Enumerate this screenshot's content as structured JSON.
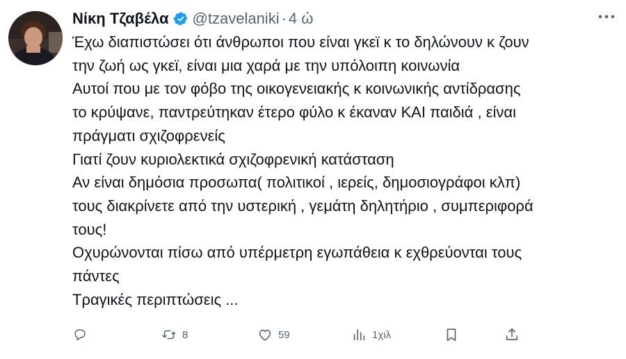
{
  "author": {
    "name": "Νίκη Τζαβέλα",
    "handle": "@tzavelaniki",
    "separator": "·",
    "time": "4 ώ",
    "verified": true
  },
  "avatar_icon": "profile-photo",
  "more_icon": "more-horizontal-icon",
  "tweet_lines": [
    "Έχω διαπιστώσει ότι άνθρωποι που είναι γκεϊ κ το δηλώνουν κ ζουν",
    "την ζωή ως γκεϊ, είναι μια χαρά με την υπόλοιπη κοινωνία",
    "Αυτοί που με τον φόβο της οικογενειακής κ κοινωνικής αντίδρασης",
    "το κρύψανε, παντρεύτηκαν έτερο φύλο κ έκαναν ΚΑΙ παιδιά , είναι",
    "πράγματι σχιζοφρενείς",
    "Γιατί ζουν κυριολεκτικά σχιζοφρενική κατάσταση",
    "Αν είναι δημόσια προσωπα( πολιτικοί , ιερείς, δημοσιογράφοι κλπ)",
    "τους διακρίνετε από την υστερική , γεμάτη δηλητήριο , συμπεριφορά",
    "τους!",
    "Οχυρώνονται πίσω από υπέρμετρη εγωπάθεια κ εχθρεύονται τους",
    "πάντες",
    "Τραγικές περιπτώσεις ..."
  ],
  "actions": {
    "reply": {
      "icon": "reply-icon",
      "count": ""
    },
    "retweet": {
      "icon": "retweet-icon",
      "count": "8"
    },
    "like": {
      "icon": "heart-icon",
      "count": "59"
    },
    "views": {
      "icon": "views-icon",
      "count": "1χιλ"
    },
    "bookmark": {
      "icon": "bookmark-icon"
    },
    "share": {
      "icon": "share-icon"
    }
  },
  "colors": {
    "text": "#0f1419",
    "muted": "#536471",
    "verified": "#1d9bf0",
    "background": "#ffffff"
  }
}
